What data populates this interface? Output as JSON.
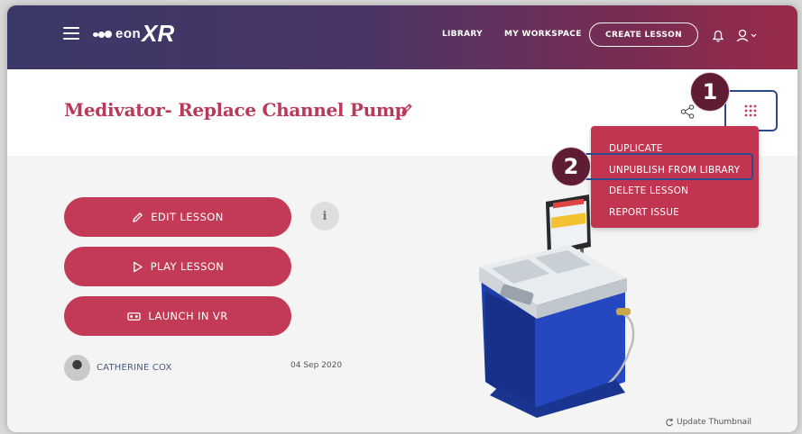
{
  "header": {
    "logo_text": "eon",
    "logo_xr": "XR",
    "nav": {
      "library": "LIBRARY",
      "workspace": "MY WORKSPACE"
    },
    "create_lesson": "CREATE LESSON"
  },
  "lesson": {
    "title": "Medivator- Replace Channel Pump",
    "author": "CATHERINE COX",
    "date": "04 Sep 2020",
    "update_thumbnail": "Update Thumbnail"
  },
  "actions": {
    "edit": "EDIT LESSON",
    "play": "PLAY LESSON",
    "vr": "LAUNCH IN VR",
    "info": "i"
  },
  "menu": {
    "items": [
      "DUPLICATE",
      "UNPUBLISH FROM LIBRARY",
      "DELETE LESSON",
      "REPORT ISSUE"
    ]
  },
  "callouts": {
    "one": "1",
    "two": "2"
  },
  "colors": {
    "brand_red": "#c23a55",
    "header_start": "#3a3868",
    "header_end": "#9a2b4a",
    "highlight_border": "#2c4a8a",
    "badge": "#5e1d33"
  },
  "icons": [
    "menu-icon",
    "bell-icon",
    "user-icon",
    "pencil-icon",
    "share-icon",
    "grid-dots-icon",
    "play-icon",
    "vr-headset-icon",
    "refresh-icon"
  ]
}
